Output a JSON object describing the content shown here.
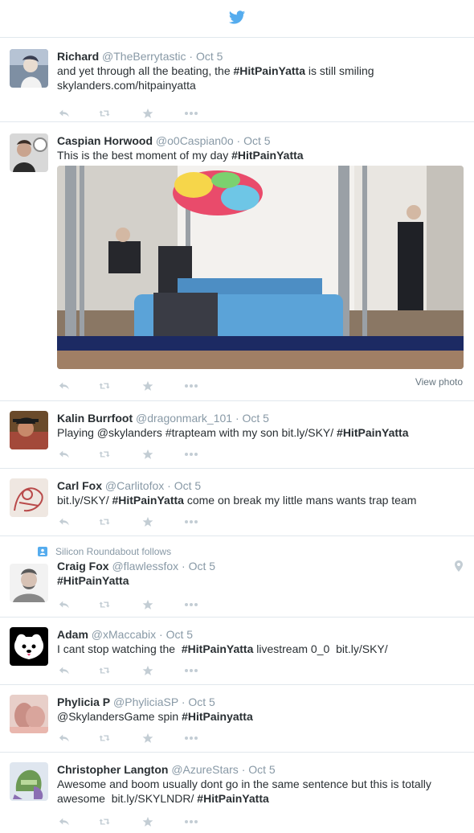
{
  "colors": {
    "brand": "#55acee",
    "name": "#292f33",
    "meta": "#8899a6",
    "divider": "#e1e8ed",
    "action": "#c3cdd4"
  },
  "header": {
    "logo_icon": "twitter-bird-icon"
  },
  "tweets": [
    {
      "name": "Richard",
      "handle": "@TheBerrytastic",
      "sep": "·",
      "time": "Oct 5",
      "text_a": "and yet through all the beating, the ",
      "tag": "#HitPainYatta",
      "text_b": " is still smiling",
      "line2": "skylanders.com/hitpainyatta"
    },
    {
      "name": "Caspian Horwood",
      "handle": "@o0Caspian0o",
      "sep": "·",
      "time": "Oct 5",
      "text_a": "This is the best moment of my day ",
      "tag": "#HitPainYatta",
      "view_photo": "View photo"
    },
    {
      "name": "Kalin Burrfoot",
      "handle": "@dragonmark_101",
      "sep": "·",
      "time": "Oct 5",
      "text_a": "Playing @skylanders #trapteam with my son bit.ly/SKY/ ",
      "tag": "#HitPainYatta"
    },
    {
      "name": "Carl Fox",
      "handle": "@Carlitofox",
      "sep": "·",
      "time": "Oct 5",
      "text_a": "bit.ly/SKY/ ",
      "tag": "#HitPainYatta",
      "text_b": " come on break my little mans wants trap team"
    },
    {
      "social": "Silicon Roundabout follows",
      "name": "Craig Fox",
      "handle": "@flawlessfox",
      "sep": "·",
      "time": "Oct 5",
      "tag": "#HitPainYatta"
    },
    {
      "name": "Adam",
      "handle": "@xMaccabix",
      "sep": "·",
      "time": "Oct 5",
      "text_a": "I cant stop watching the  ",
      "tag": "#HitPainYatta",
      "text_b": " livestream 0_0  bit.ly/SKY/"
    },
    {
      "name": "Phylicia P",
      "handle": "@PhyliciaSP",
      "sep": "·",
      "time": "Oct 5",
      "text_a": "@SkylandersGame spin ",
      "tag": "#HitPainyatta"
    },
    {
      "name": "Christopher Langton",
      "handle": "@AzureStars",
      "sep": "·",
      "time": "Oct 5",
      "text_a": "Awesome and boom usually dont go in the same sentence but this is totally",
      "line2a": "awesome  bit.ly/SKYLNDR/ ",
      "tag": "#HitPainYatta"
    }
  ]
}
